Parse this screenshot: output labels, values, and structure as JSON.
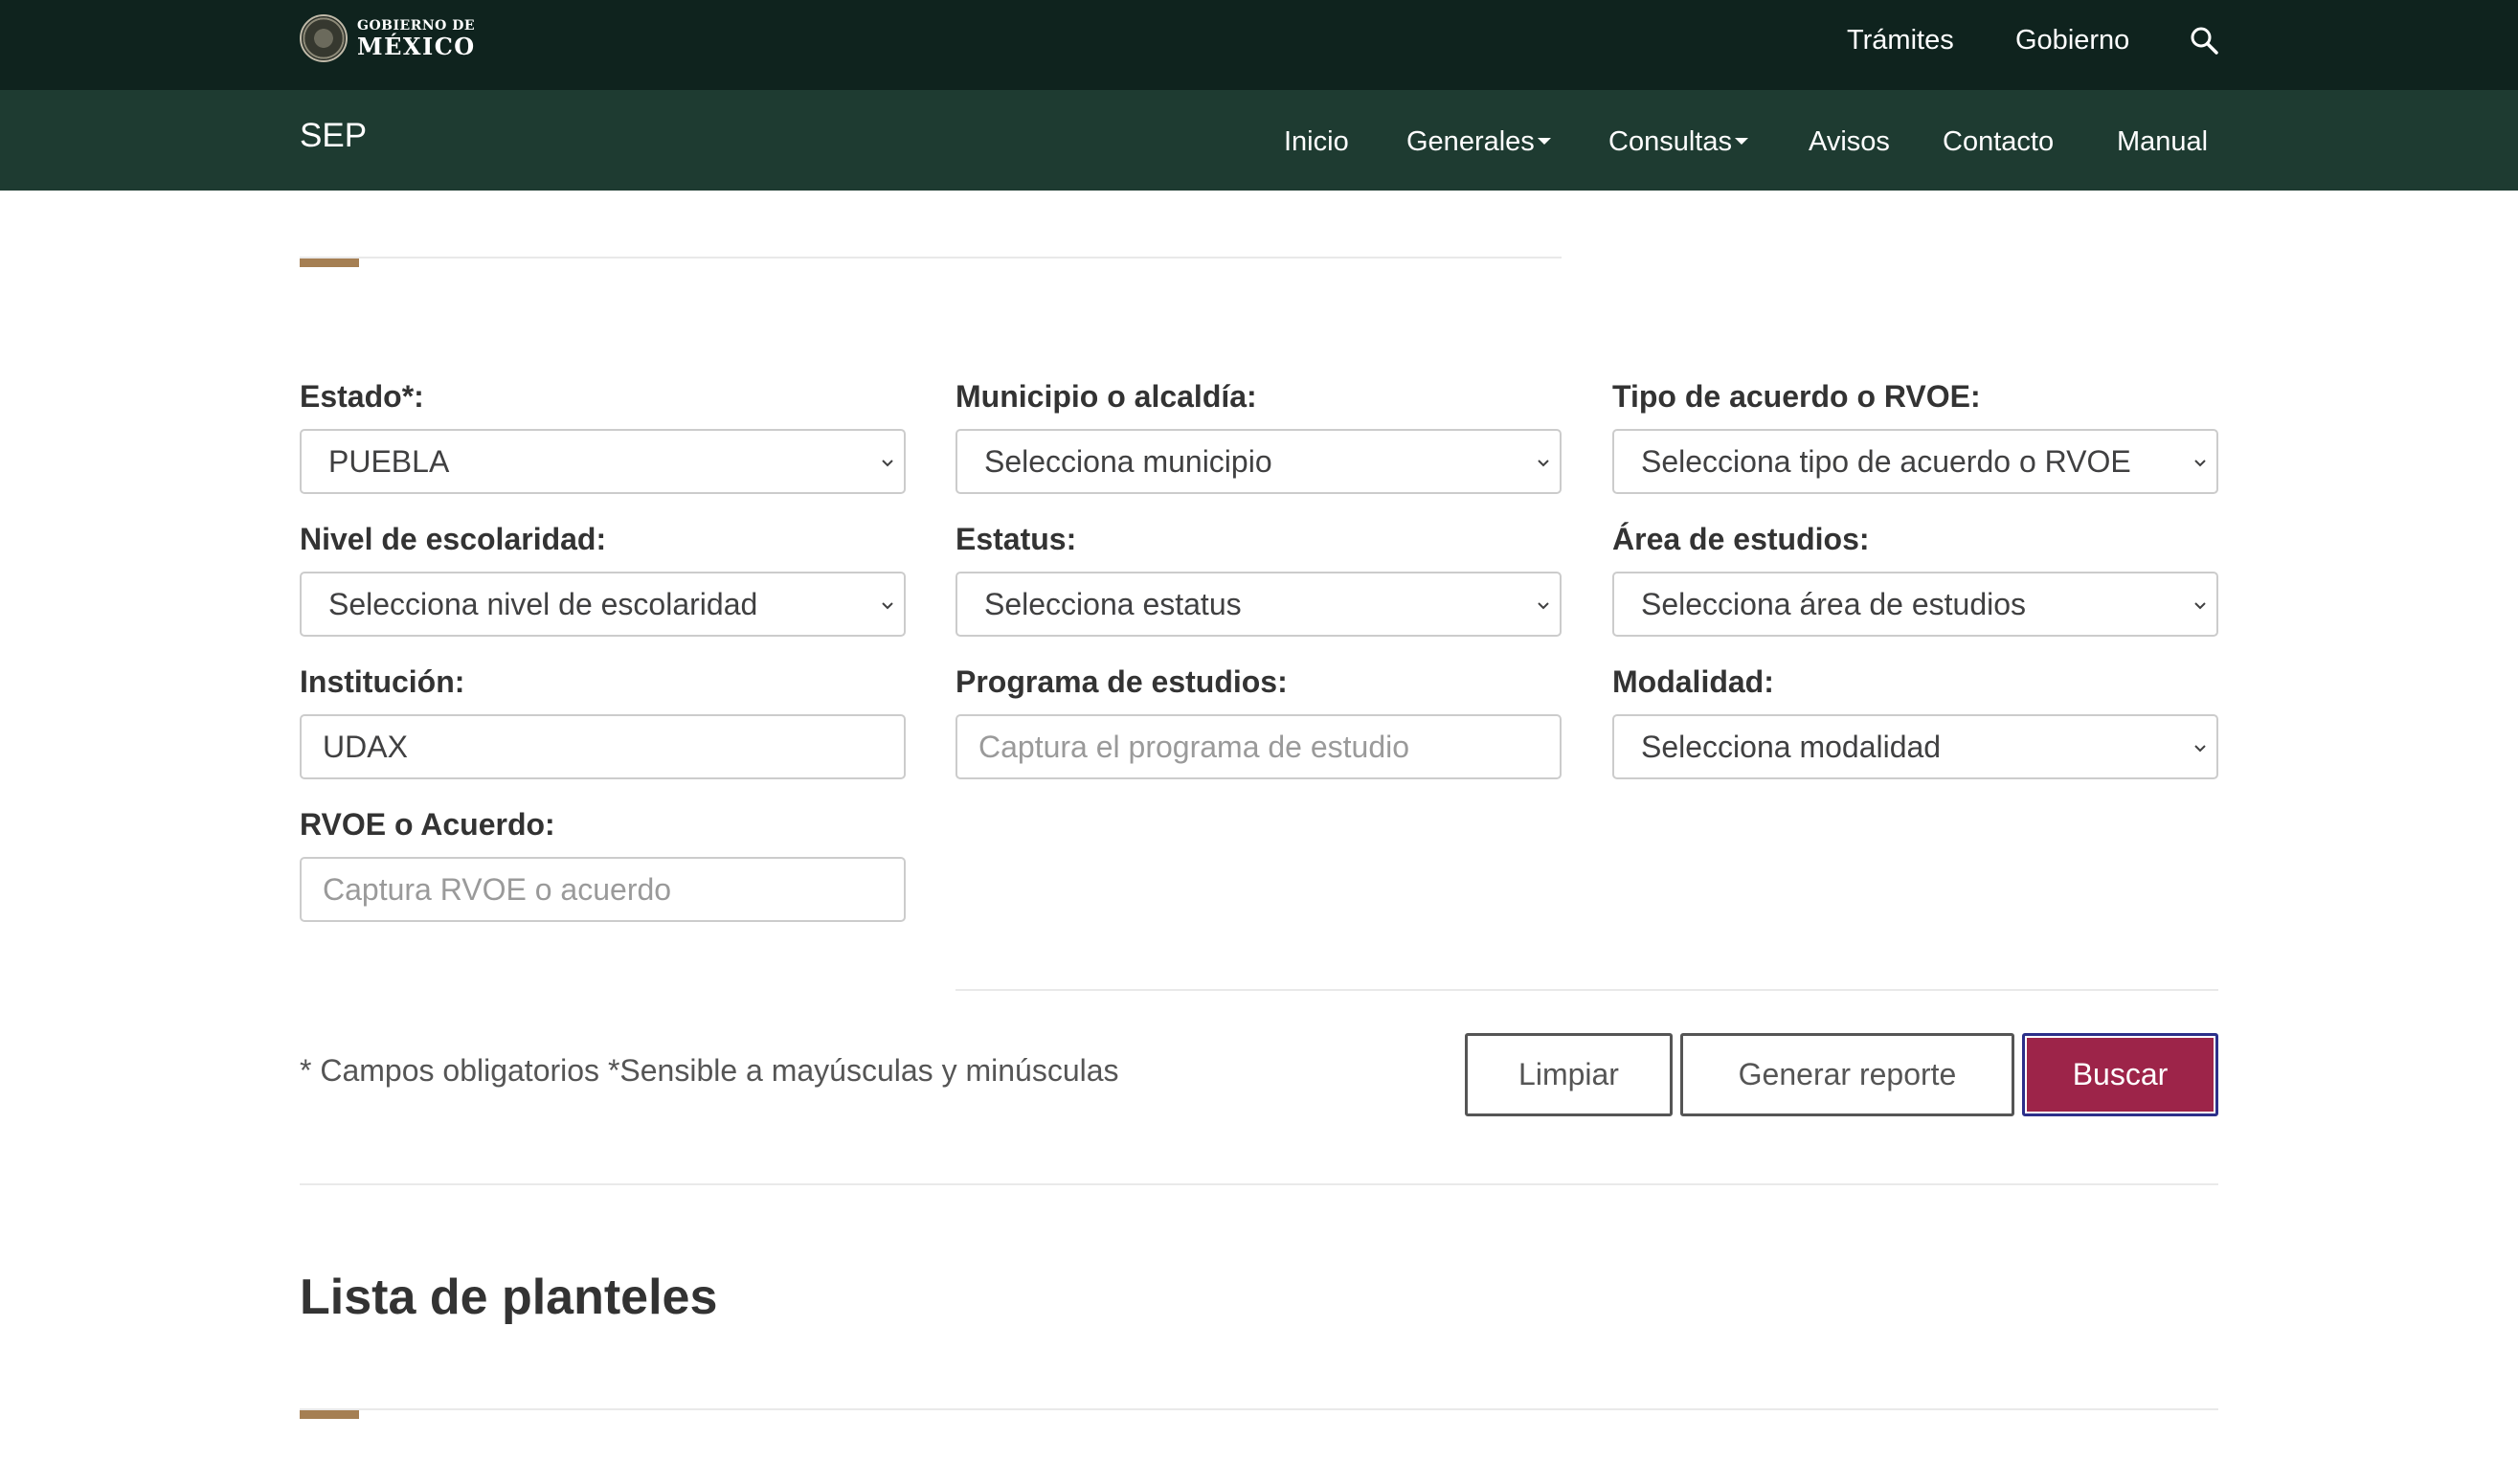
{
  "header": {
    "logo_small": "GOBIERNO DE",
    "logo_big": "MÉXICO",
    "links": [
      "Trámites",
      "Gobierno"
    ],
    "search_icon": "search-icon"
  },
  "nav": {
    "brand": "SEP",
    "items": [
      {
        "label": "Inicio",
        "dropdown": false
      },
      {
        "label": "Generales",
        "dropdown": true
      },
      {
        "label": "Consultas",
        "dropdown": true
      },
      {
        "label": "Avisos",
        "dropdown": false
      },
      {
        "label": "Contacto",
        "dropdown": false
      },
      {
        "label": "Manual",
        "dropdown": false
      }
    ]
  },
  "form": {
    "estado": {
      "label": "Estado*:",
      "value": "PUEBLA"
    },
    "municipio": {
      "label": "Municipio o alcaldía:",
      "value": "Selecciona municipio"
    },
    "tipo_acuerdo": {
      "label": "Tipo de acuerdo o RVOE:",
      "value": "Selecciona tipo de acuerdo o RVOE"
    },
    "nivel": {
      "label": "Nivel de escolaridad:",
      "value": "Selecciona nivel de escolaridad"
    },
    "estatus": {
      "label": "Estatus:",
      "value": "Selecciona estatus"
    },
    "area": {
      "label": "Área de estudios:",
      "value": "Selecciona área de estudios"
    },
    "institucion": {
      "label": "Institución:",
      "value": "UDAX",
      "placeholder": ""
    },
    "programa": {
      "label": "Programa de estudios:",
      "value": "",
      "placeholder": "Captura el programa de estudio"
    },
    "modalidad": {
      "label": "Modalidad:",
      "value": "Selecciona modalidad"
    },
    "rvoe": {
      "label": "RVOE o Acuerdo:",
      "value": "",
      "placeholder": "Captura RVOE o acuerdo"
    },
    "note": "* Campos obligatorios *Sensible a mayúsculas y minúsculas",
    "buttons": {
      "clear": "Limpiar",
      "report": "Generar reporte",
      "search": "Buscar"
    },
    "colors": {
      "primary": "#9d2449",
      "header": "#0f231e",
      "nav": "#1e3b31",
      "accent": "#a57f53"
    }
  },
  "results": {
    "title": "Lista de planteles"
  }
}
